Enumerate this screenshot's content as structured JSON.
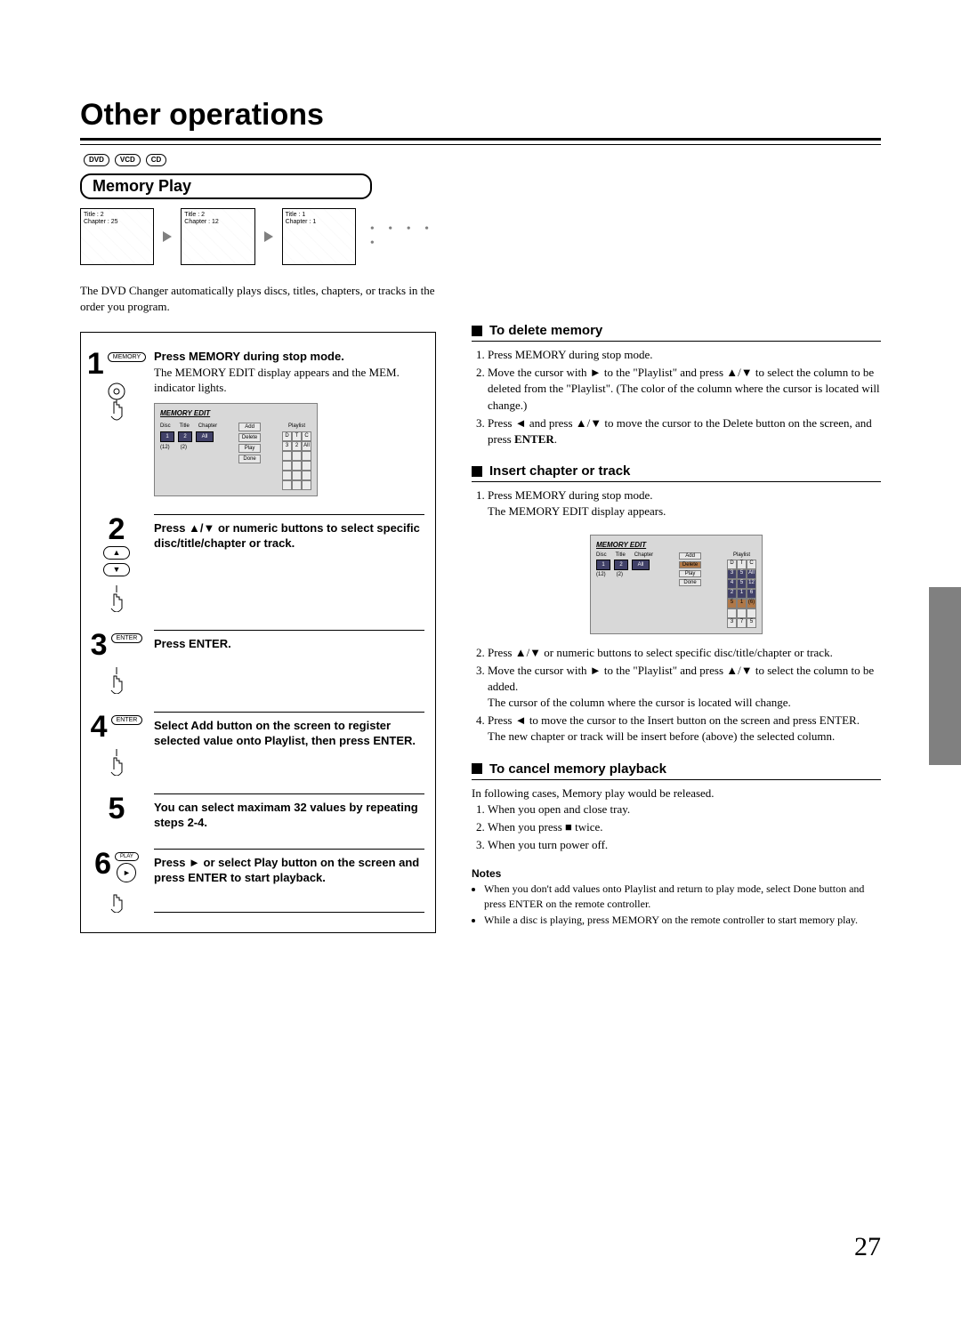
{
  "page_title": "Other operations",
  "disc_badges": [
    "DVD",
    "VCD",
    "CD"
  ],
  "feature": "Memory Play",
  "illus": [
    {
      "title": "Title : 2",
      "chapter": "Chapter : 25"
    },
    {
      "title": "Title : 2",
      "chapter": "Chapter : 12"
    },
    {
      "title": "Title : 1",
      "chapter": "Chapter : 1"
    }
  ],
  "intro": "The DVD Changer automatically plays discs, titles, chapters, or tracks in the order you program.",
  "memory_edit_label": "MEMORY EDIT",
  "mini1": {
    "cols": [
      "Disc",
      "Title",
      "Chapter"
    ],
    "vals": [
      "1",
      "2",
      "All"
    ],
    "under": [
      "(12)",
      "(2)"
    ],
    "btns": [
      "Add",
      "Delete",
      "Play",
      "Done"
    ],
    "playlist": "Playlist",
    "plhead": [
      "D",
      "T",
      "C"
    ],
    "plrow": [
      "3",
      "2",
      "All"
    ]
  },
  "mini2": {
    "plrows": [
      [
        "3",
        "5",
        "All"
      ],
      [
        "4",
        "5",
        "12"
      ],
      [
        "2",
        "1",
        "6"
      ],
      [
        "5",
        "1",
        "(6)"
      ],
      [
        "",
        "",
        ""
      ],
      [
        "3",
        "7",
        "5"
      ]
    ]
  },
  "steps": [
    {
      "n": "1",
      "icon": "memory",
      "title": "Press MEMORY during stop mode.",
      "body": "The MEMORY EDIT display appears and the MEM. indicator lights.",
      "btn": "MEMORY"
    },
    {
      "n": "2",
      "icon": "updown",
      "title": "Press ▲/▼ or numeric buttons to select specific disc/title/chapter or track.",
      "body": ""
    },
    {
      "n": "3",
      "icon": "enterhand",
      "title": "Press ENTER.",
      "body": "",
      "btn": "ENTER"
    },
    {
      "n": "4",
      "icon": "enterhand",
      "title": "Select Add button on the screen to register selected value onto Playlist, then press ENTER.",
      "body": "",
      "btn": "ENTER"
    },
    {
      "n": "5",
      "icon": "",
      "title": "You can select maximam 32 values by repeating steps 2-4.",
      "body": ""
    },
    {
      "n": "6",
      "icon": "playhand",
      "title": "Press ► or select Play button on the screen and press ENTER to start playback.",
      "body": "",
      "btn": "PLAY"
    }
  ],
  "right": {
    "delete": {
      "head": "To delete memory",
      "items": [
        "Press MEMORY during stop mode.",
        "Move the cursor with ► to the \"Playlist\" and press ▲/▼ to select the column to be deleted from the \"Playlist\". (The color of the column where the cursor is located will change.)",
        "Press ◄ and press ▲/▼ to move the cursor to the Delete button on the screen, and press <b>ENTER</b>."
      ]
    },
    "insert": {
      "head": "Insert chapter or track",
      "pre": [
        "Press MEMORY during stop mode.<br>The MEMORY EDIT display appears."
      ],
      "post": [
        "Press ▲/▼ or numeric buttons to select specific disc/title/chapter or track.",
        "Move the cursor with ► to the \"Playlist\" and press ▲/▼ to select the column to be added.<br>The cursor of the column where the cursor is located will change.",
        "Press ◄ to move the cursor to the Insert button on the screen and press ENTER.<br>The new chapter or track will be insert before (above) the selected column."
      ]
    },
    "cancel": {
      "head": "To cancel memory playback",
      "intro": "In following cases, Memory play would be released.",
      "items": [
        "When you open and close tray.",
        "When you press ■ twice.",
        "When you turn power off."
      ]
    },
    "notes_head": "Notes",
    "notes": [
      "When you don't add values onto Playlist and return to play mode, select Done button and press ENTER on the remote controller.",
      "While a disc is playing, press MEMORY on the remote controller to start memory play."
    ]
  },
  "page_number": "27"
}
